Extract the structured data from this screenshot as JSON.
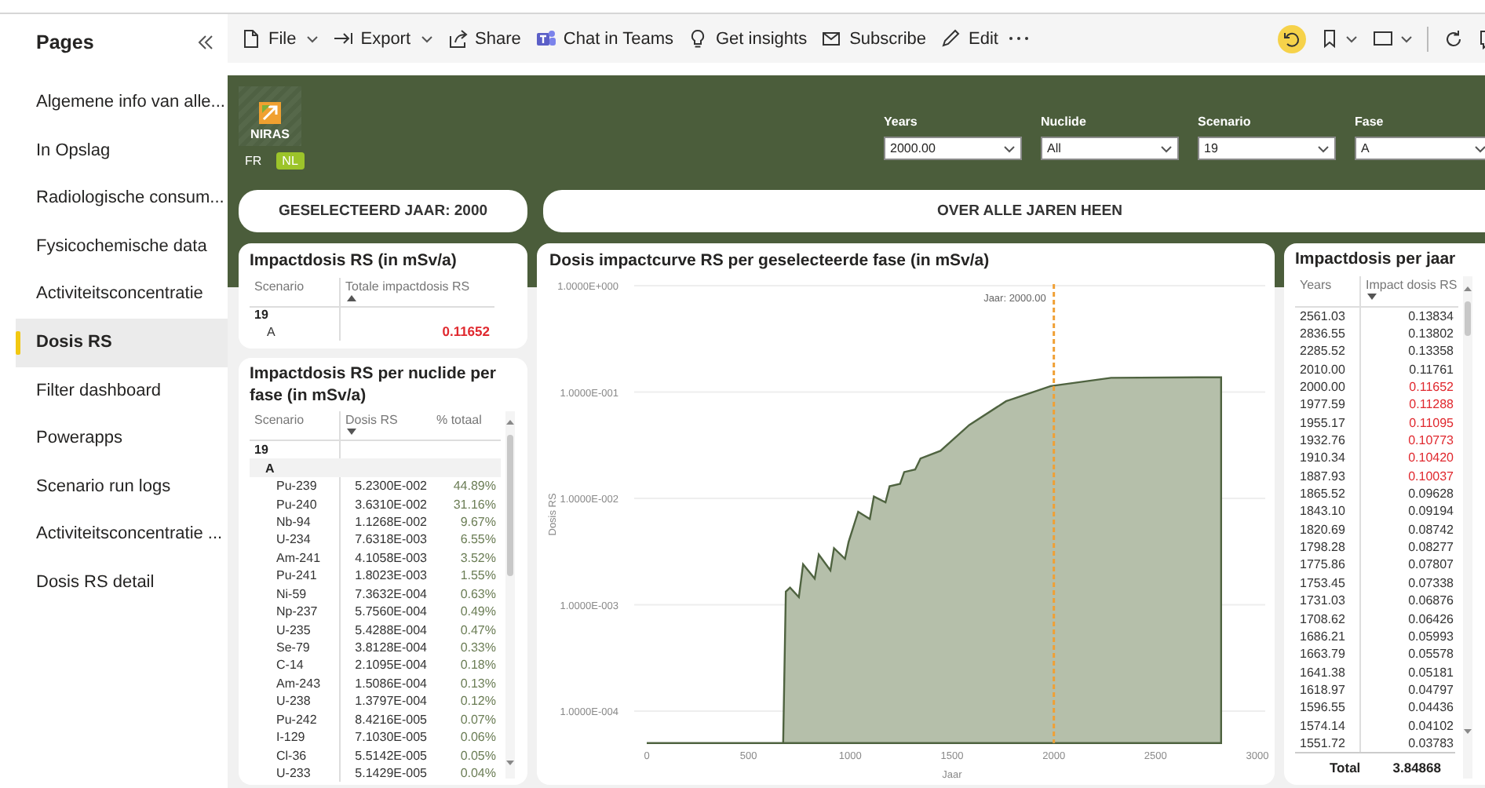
{
  "sidebar": {
    "title": "Pages",
    "items": [
      {
        "label": "Algemene info van alle...",
        "selected": false
      },
      {
        "label": "In Opslag",
        "selected": false
      },
      {
        "label": "Radiologische consum...",
        "selected": false
      },
      {
        "label": "Fysicochemische data",
        "selected": false
      },
      {
        "label": "Activiteitsconcentratie",
        "selected": false
      },
      {
        "label": "Dosis RS",
        "selected": true
      },
      {
        "label": "Filter dashboard",
        "selected": false
      },
      {
        "label": "Powerapps",
        "selected": false
      },
      {
        "label": "Scenario run logs",
        "selected": false
      },
      {
        "label": "Activiteitsconcentratie ...",
        "selected": false
      },
      {
        "label": "Dosis RS detail",
        "selected": false
      }
    ]
  },
  "toolbar": {
    "items": [
      {
        "kind": "file",
        "label": "File",
        "has_menu": true
      },
      {
        "kind": "export",
        "label": "Export",
        "has_menu": true
      },
      {
        "kind": "share",
        "label": "Share",
        "has_menu": false
      },
      {
        "kind": "teams",
        "label": "Chat in Teams",
        "has_menu": false
      },
      {
        "kind": "insights",
        "label": "Get insights",
        "has_menu": false
      },
      {
        "kind": "subscribe",
        "label": "Subscribe",
        "has_menu": false
      },
      {
        "kind": "edit",
        "label": "Edit",
        "has_menu": false
      }
    ]
  },
  "header": {
    "logo_text": "NIRAS",
    "languages": [
      {
        "label": "FR",
        "selected": false
      },
      {
        "label": "NL",
        "selected": true
      }
    ],
    "slicers": [
      {
        "label": "Years",
        "value": "2000.00"
      },
      {
        "label": "Nuclide",
        "value": "All"
      },
      {
        "label": "Scenario",
        "value": "19"
      },
      {
        "label": "Fase",
        "value": "A"
      }
    ]
  },
  "buttons": [
    {
      "label": "GESELECTEERD JAAR: 2000"
    },
    {
      "label": "OVER ALLE JAREN HEEN"
    }
  ],
  "total_card": {
    "title": "Impactdosis RS (in mSv/a)",
    "columns": [
      {
        "label": "Scenario",
        "sorted": false
      },
      {
        "label": "Totale impactdosis RS",
        "sorted": true,
        "descending": false
      }
    ],
    "rows": [
      {
        "label": "19",
        "children": [
          {
            "label": "A",
            "values": [
              "0.11652"
            ],
            "highlighted": true
          }
        ]
      }
    ]
  },
  "nuclide_card": {
    "title": "Impactdosis RS per nuclide per fase (in mSv/a)",
    "columns": [
      {
        "label": "Scenario",
        "sorted": false
      },
      {
        "label": "Dosis RS",
        "sorted": true,
        "descending": true
      },
      {
        "label": "% totaal",
        "sorted": false
      }
    ],
    "rows": [
      {
        "label": "19",
        "children": [
          {
            "label": "A",
            "children": [
              {
                "label": "Pu-239",
                "values": [
                  "5.2300E-002",
                  "44.89%"
                ]
              },
              {
                "label": "Pu-240",
                "values": [
                  "3.6310E-002",
                  "31.16%"
                ]
              },
              {
                "label": "Nb-94",
                "values": [
                  "1.1268E-002",
                  "9.67%"
                ]
              },
              {
                "label": "U-234",
                "values": [
                  "7.6318E-003",
                  "6.55%"
                ]
              },
              {
                "label": "Am-241",
                "values": [
                  "4.1058E-003",
                  "3.52%"
                ]
              },
              {
                "label": "Pu-241",
                "values": [
                  "1.8023E-003",
                  "1.55%"
                ]
              },
              {
                "label": "Ni-59",
                "values": [
                  "7.3632E-004",
                  "0.63%"
                ]
              },
              {
                "label": "Np-237",
                "values": [
                  "5.7560E-004",
                  "0.49%"
                ]
              },
              {
                "label": "U-235",
                "values": [
                  "5.4288E-004",
                  "0.47%"
                ]
              },
              {
                "label": "Se-79",
                "values": [
                  "3.8128E-004",
                  "0.33%"
                ]
              },
              {
                "label": "C-14",
                "values": [
                  "2.1095E-004",
                  "0.18%"
                ]
              },
              {
                "label": "Am-243",
                "values": [
                  "1.5086E-004",
                  "0.13%"
                ]
              },
              {
                "label": "U-238",
                "values": [
                  "1.3797E-004",
                  "0.12%"
                ]
              },
              {
                "label": "Pu-242",
                "values": [
                  "8.4216E-005",
                  "0.07%"
                ]
              },
              {
                "label": "I-129",
                "values": [
                  "7.1030E-005",
                  "0.06%"
                ]
              },
              {
                "label": "Cl-36",
                "values": [
                  "5.5142E-005",
                  "0.05%"
                ]
              },
              {
                "label": "U-233",
                "values": [
                  "5.1429E-005",
                  "0.04%"
                ]
              }
            ]
          }
        ]
      }
    ]
  },
  "chart_card": {
    "title": "Dosis impactcurve RS per geselecteerde fase (in mSv/a)",
    "y_tick_labels": [
      "1.0000E+000",
      "1.0000E-001",
      "1.0000E-002",
      "1.0000E-003",
      "1.0000E-004"
    ],
    "x_tick_labels": [
      "0",
      "500",
      "1000",
      "1500",
      "2000",
      "2500",
      "3000"
    ],
    "xlabel": "Jaar",
    "ylabel": "Dosis RS",
    "marker_label": "Jaar: 2000.00"
  },
  "year_card": {
    "title": "Impactdosis per jaar",
    "columns": [
      {
        "label": "Years",
        "sorted": false
      },
      {
        "label": "Impact dosis RS",
        "sorted": true,
        "descending": true
      }
    ],
    "rows": [
      {
        "values": [
          "2561.03",
          "0.13834"
        ],
        "highlighted": false
      },
      {
        "values": [
          "2836.55",
          "0.13802"
        ],
        "highlighted": false
      },
      {
        "values": [
          "2285.52",
          "0.13358"
        ],
        "highlighted": false
      },
      {
        "values": [
          "2010.00",
          "0.11761"
        ],
        "highlighted": false
      },
      {
        "values": [
          "2000.00",
          "0.11652"
        ],
        "highlighted": true
      },
      {
        "values": [
          "1977.59",
          "0.11288"
        ],
        "highlighted": true
      },
      {
        "values": [
          "1955.17",
          "0.11095"
        ],
        "highlighted": true
      },
      {
        "values": [
          "1932.76",
          "0.10773"
        ],
        "highlighted": true
      },
      {
        "values": [
          "1910.34",
          "0.10420"
        ],
        "highlighted": true
      },
      {
        "values": [
          "1887.93",
          "0.10037"
        ],
        "highlighted": true
      },
      {
        "values": [
          "1865.52",
          "0.09628"
        ],
        "highlighted": false
      },
      {
        "values": [
          "1843.10",
          "0.09194"
        ],
        "highlighted": false
      },
      {
        "values": [
          "1820.69",
          "0.08742"
        ],
        "highlighted": false
      },
      {
        "values": [
          "1798.28",
          "0.08277"
        ],
        "highlighted": false
      },
      {
        "values": [
          "1775.86",
          "0.07807"
        ],
        "highlighted": false
      },
      {
        "values": [
          "1753.45",
          "0.07338"
        ],
        "highlighted": false
      },
      {
        "values": [
          "1731.03",
          "0.06876"
        ],
        "highlighted": false
      },
      {
        "values": [
          "1708.62",
          "0.06426"
        ],
        "highlighted": false
      },
      {
        "values": [
          "1686.21",
          "0.05993"
        ],
        "highlighted": false
      },
      {
        "values": [
          "1663.79",
          "0.05578"
        ],
        "highlighted": false
      },
      {
        "values": [
          "1641.38",
          "0.05181"
        ],
        "highlighted": false
      },
      {
        "values": [
          "1618.97",
          "0.04797"
        ],
        "highlighted": false
      },
      {
        "values": [
          "1596.55",
          "0.04436"
        ],
        "highlighted": false
      },
      {
        "values": [
          "1574.14",
          "0.04102"
        ],
        "highlighted": false
      },
      {
        "values": [
          "1551.72",
          "0.03783"
        ],
        "highlighted": false
      }
    ],
    "total": {
      "label": "Total",
      "values": [
        "3.84868"
      ]
    }
  }
}
